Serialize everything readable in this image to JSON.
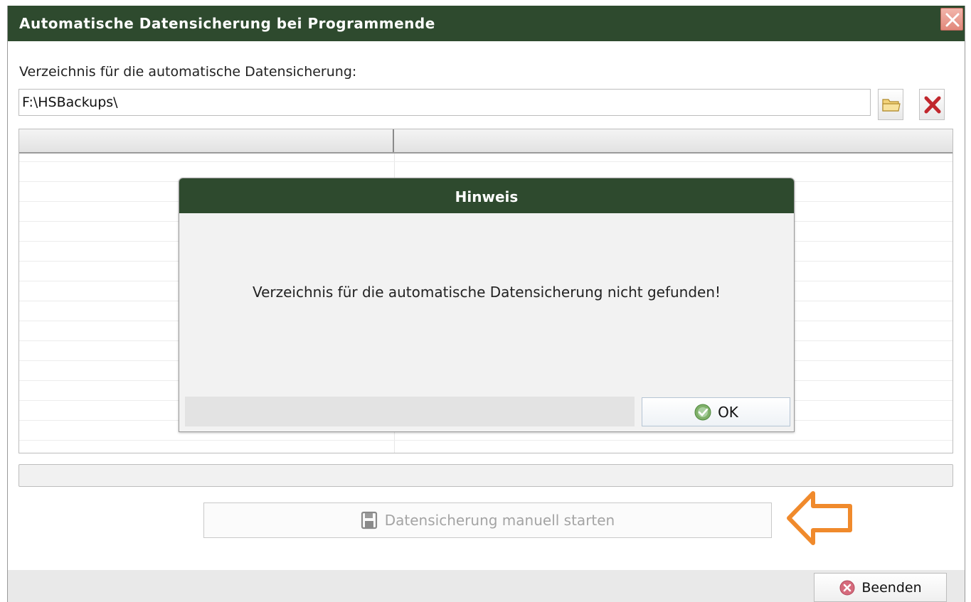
{
  "window": {
    "title": "Automatische Datensicherung bei Programmende",
    "close_icon": "close-icon"
  },
  "directory": {
    "label": "Verzeichnis für die automatische Datensicherung:",
    "value": "F:\\HSBackups\\",
    "browse_icon": "folder-icon",
    "delete_icon": "delete-x-icon"
  },
  "grid": {
    "columns": [
      "",
      ""
    ],
    "rows": []
  },
  "start_button": {
    "label": "Datensicherung manuell starten",
    "icon": "floppy-disk-icon",
    "enabled": false
  },
  "annotation": {
    "icon": "orange-arrow-left-icon",
    "color": "#f08a2c"
  },
  "exit_button": {
    "label": "Beenden",
    "icon": "cancel-icon"
  },
  "dialog": {
    "title": "Hinweis",
    "message": "Verzeichnis für die automatische Datensicherung nicht gefunden!",
    "ok_label": "OK",
    "ok_icon": "ok-check-icon"
  },
  "colors": {
    "title_bar": "#2e4a2e",
    "title_text": "#ffffff",
    "arrow": "#f08a2c"
  }
}
